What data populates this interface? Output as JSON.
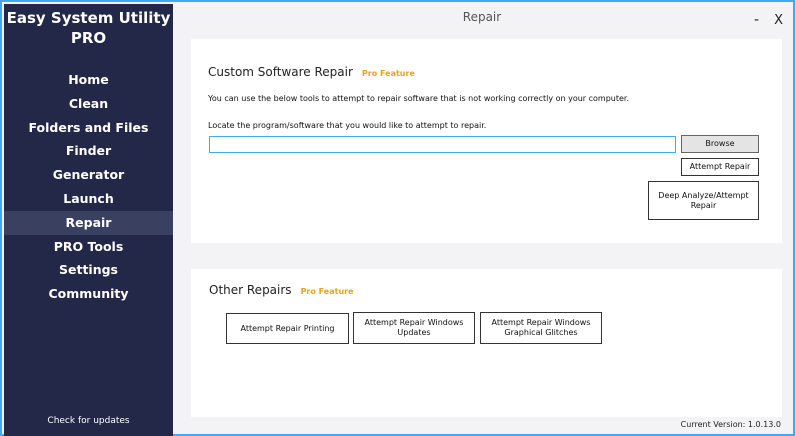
{
  "app": {
    "title_line1": "Easy System Utility",
    "title_line2": "PRO"
  },
  "sidebar": {
    "items": [
      {
        "label": "Home"
      },
      {
        "label": "Clean"
      },
      {
        "label": "Folders and Files"
      },
      {
        "label": "Finder"
      },
      {
        "label": "Generator"
      },
      {
        "label": "Launch"
      },
      {
        "label": "Repair",
        "active": true
      },
      {
        "label": "PRO Tools"
      },
      {
        "label": "Settings"
      },
      {
        "label": "Community"
      }
    ],
    "check_updates": "Check for updates"
  },
  "window": {
    "title": "Repair",
    "minimize_glyph": "-",
    "close_glyph": "X"
  },
  "custom_repair": {
    "title": "Custom Software Repair",
    "pro_tag": "Pro Feature",
    "description": "You can use the below tools to attempt to repair software that is not working correctly on your computer.",
    "locate_label": "Locate the program/software that you would like to attempt to repair.",
    "path_value": "",
    "browse_label": "Browse",
    "attempt_repair_label": "Attempt Repair",
    "deep_analyze_label": "Deep Analyze/Attempt Repair"
  },
  "other_repairs": {
    "title": "Other Repairs",
    "pro_tag": "Pro Feature",
    "printing_label": "Attempt Repair Printing",
    "windows_updates_label": "Attempt Repair Windows Updates",
    "graphical_glitches_label": "Attempt Repair Windows Graphical Glitches"
  },
  "footer": {
    "version": "Current Version: 1.0.13.0"
  },
  "colors": {
    "sidebar_bg": "#232848",
    "sidebar_active": "#3a4060",
    "accent_border": "#3fa9f5",
    "pro_tag": "#e8a317"
  }
}
